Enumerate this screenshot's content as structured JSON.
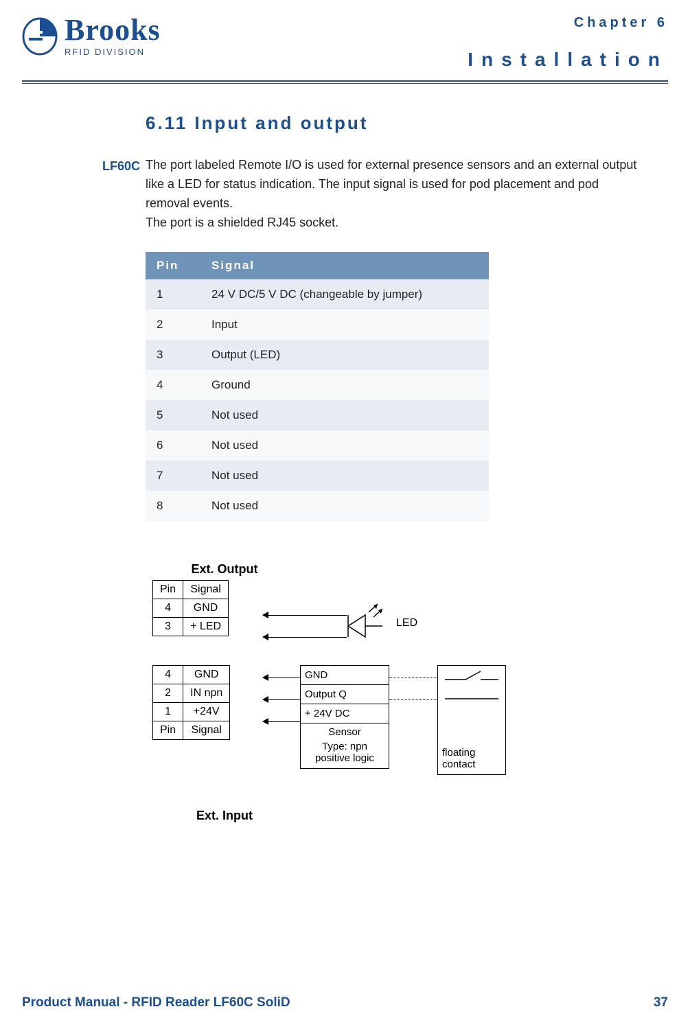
{
  "logo": {
    "brand": "Brooks",
    "division": "RFID DIVISION"
  },
  "header": {
    "chapter_label": "Chapter 6",
    "chapter_title": "Installation"
  },
  "section": {
    "number_title": "6.11 Input and output",
    "side_label": "LF60C",
    "paragraph1": "The port labeled Remote I/O is used for external presence sensors and an external output like a LED for status indication. The input signal is used for pod placement and pod removal events.",
    "paragraph2": "The port is a shielded RJ45 socket."
  },
  "pin_table": {
    "headers": {
      "pin": "Pin",
      "signal": "Signal"
    },
    "rows": [
      {
        "pin": "1",
        "signal": "24 V DC/5 V DC (changeable by jumper)"
      },
      {
        "pin": "2",
        "signal": "Input"
      },
      {
        "pin": "3",
        "signal": "Output (LED)"
      },
      {
        "pin": "4",
        "signal": "Ground"
      },
      {
        "pin": "5",
        "signal": "Not used"
      },
      {
        "pin": "6",
        "signal": "Not used"
      },
      {
        "pin": "7",
        "signal": "Not used"
      },
      {
        "pin": "8",
        "signal": "Not used"
      }
    ]
  },
  "diagram": {
    "ext_output_title": "Ext. Output",
    "ext_input_title": "Ext. Input",
    "col_pin": "Pin",
    "col_signal": "Signal",
    "out_rows": [
      {
        "pin": "4",
        "signal": "GND"
      },
      {
        "pin": "3",
        "signal": "+ LED"
      }
    ],
    "in_rows": [
      {
        "pin": "4",
        "signal": "GND"
      },
      {
        "pin": "2",
        "signal": "IN npn"
      },
      {
        "pin": "1",
        "signal": "+24V"
      }
    ],
    "led_label": "LED",
    "sensor_box": {
      "gnd": "GND",
      "outq": "Output Q",
      "v24": "+ 24V DC",
      "sensor": "Sensor",
      "type": "Type: npn",
      "logic": "positive logic"
    },
    "floating_contact": "floating\ncontact"
  },
  "footer": {
    "manual": "Product Manual - RFID Reader LF60C SoliD",
    "page": "37"
  }
}
